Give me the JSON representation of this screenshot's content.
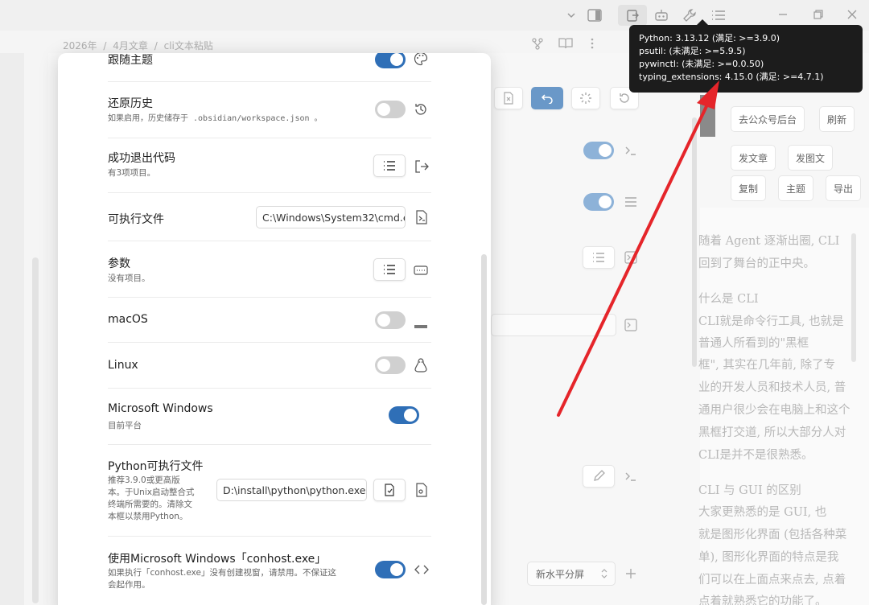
{
  "breadcrumb": [
    "2026年",
    "/",
    "4月文章",
    "/",
    "cli文本粘贴"
  ],
  "modal": {
    "rows": [
      {
        "title": "跟随主题",
        "icon": "palette-icon"
      },
      {
        "title": "还原历史",
        "desc": "如果启用，历史储存于 .obsidian/workspace.json 。",
        "icon": "history-icon"
      },
      {
        "title": "成功退出代码",
        "desc": "有3项项目。",
        "icon": "exit-icon"
      },
      {
        "title": "可执行文件",
        "value": "C:\\Windows\\System32\\cmd.e",
        "icon": "terminal-file-icon"
      },
      {
        "title": "参数",
        "desc": "没有项目。",
        "icon": "keyboard-icon"
      },
      {
        "title": "macOS",
        "icon": "apple-icon"
      },
      {
        "title": "Linux",
        "icon": "linux-icon"
      },
      {
        "title": "Microsoft Windows",
        "desc": "目前平台"
      },
      {
        "title": "Python可执行文件",
        "desc_lines": [
          "推荐3.9.0或更高版",
          "本。于Unix启动整合式",
          "终端所需要的。清除文",
          "本框以禁用Python。"
        ],
        "value": "D:\\install\\python\\python.exe",
        "icon": "file-code-icon"
      },
      {
        "title": "使用Microsoft Windows「conhost.exe」",
        "desc_lines": [
          "如果执行「conhost.exe」没有创建视窗，请禁用。不保证这",
          "会起作用。"
        ],
        "icon": "code-icon"
      }
    ]
  },
  "tooltip": {
    "lines": [
      "Python: 3.13.12 (满足: >=3.9.0)",
      "psutil: (未满足: >=5.9.5)",
      "pywinctl: (未满足: >=0.0.50)",
      "typing_extensions: 4.15.0 (满足: >=4.7.1)"
    ]
  },
  "right_pane": {
    "buttons": [
      "去公众号后台",
      "刷新",
      "发文章",
      "发图文",
      "复制",
      "主题",
      "导出"
    ]
  },
  "article_lines": [
    "随着 Agent 逐渐出圈, CLI",
    "回到了舞台的正中央。",
    "什么是 CLI",
    "CLI就是命令行工具, 也就是",
    "普通人所看到的\"黑框",
    "框\", 其实在几年前, 除了专",
    "业的开发人员和技术人员, 普",
    "通用户很少会在电脑上和这个",
    "黑框打交道, 所以大部分人对",
    "CLI是并不是很熟悉。",
    "CLI 与 GUI 的区别",
    "大家更熟悉的是 GUI, 也",
    "就是图形化界面 (包括各种菜",
    "单), 图形化界面的特点是我",
    "们可以在上面点来点去, 点着",
    "点着就熟悉它的功能了。"
  ],
  "split_select": "新水平分屏",
  "colors": {
    "accent": "#2f6fb7",
    "arrow": "#e5252a",
    "tooltip_bg": "#1c1c1c"
  }
}
